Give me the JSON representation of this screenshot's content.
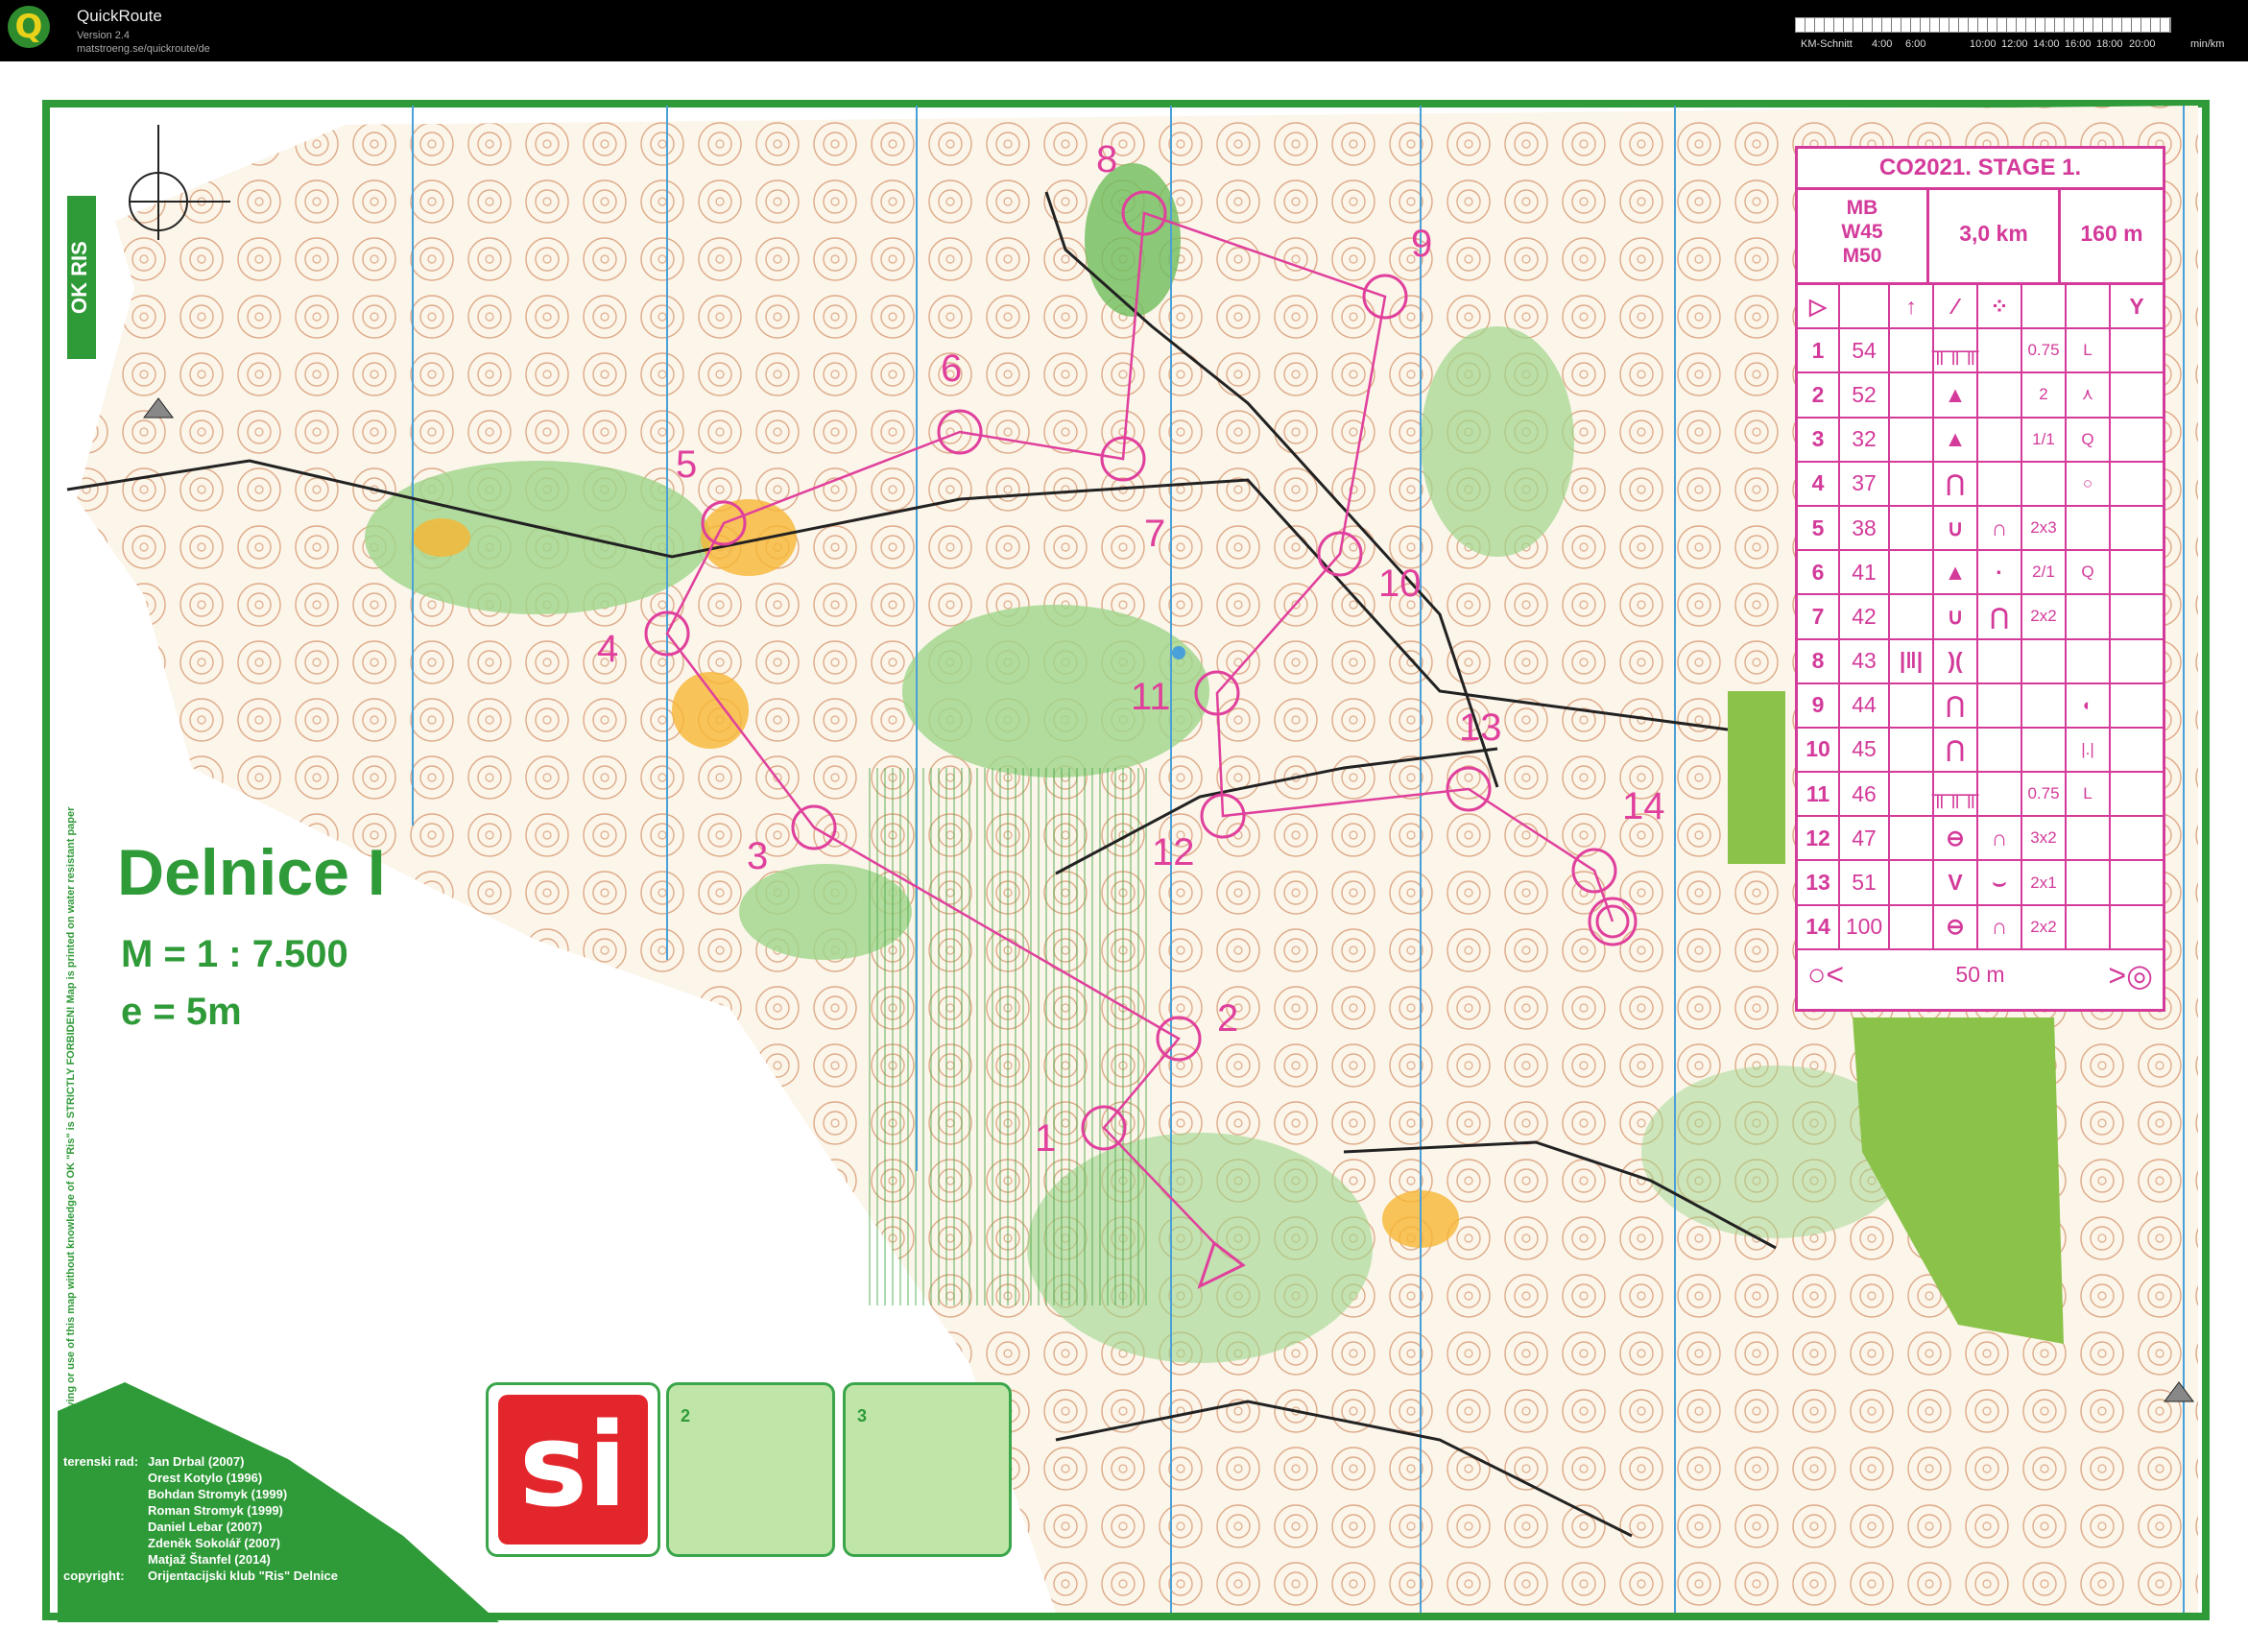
{
  "app": {
    "name": "QuickRoute",
    "version": "Version 2.4",
    "url": "matstroeng.se/quickroute/de"
  },
  "speed_legend": {
    "label": "KM-Schnitt",
    "ticks_a": [
      "4:00",
      "6:00"
    ],
    "ticks_b": [
      "10:00",
      "12:00",
      "14:00",
      "16:00",
      "18:00",
      "20:00"
    ],
    "unit": "min/km"
  },
  "map": {
    "name": "Delnice I",
    "scale": "M = 1 : 7.500",
    "equidistance": "e = 5m",
    "club_logo": "OK RIS",
    "copyright_note": "Any kind of copying or use of this map without knowledge of OK \"Ris\" is STRICTLY FORBIDEN!  Map is printed on water resistant paper",
    "credits": [
      {
        "label": "terenski rad:",
        "name": "Jan Drbal (2007)"
      },
      {
        "label": "",
        "name": "Orest Kotylo (1996)"
      },
      {
        "label": "",
        "name": "Bohdan Stromyk (1999)"
      },
      {
        "label": "",
        "name": "Roman Stromyk (1999)"
      },
      {
        "label": "",
        "name": "Daniel Lebar (2007)"
      },
      {
        "label": "",
        "name": "Zdeněk Sokolář (2007)"
      },
      {
        "label": "",
        "name": "Matjaž Štanfel (2014)"
      },
      {
        "label": "copyright:",
        "name": "Orijentacijski klub \"Ris\" Delnice"
      }
    ],
    "sponsor_logo": "si",
    "promo_numbers": [
      "2",
      "3"
    ]
  },
  "course": {
    "title": "CO2021. STAGE 1.",
    "classes": [
      "MB",
      "W45",
      "M50"
    ],
    "length": "3,0 km",
    "climb": "160 m",
    "controls": [
      {
        "n": "1",
        "code": "54",
        "d": "",
        "e": "╥╥╥",
        "f": "",
        "g": "0.75",
        "h": "L"
      },
      {
        "n": "2",
        "code": "52",
        "d": "",
        "e": "▲",
        "f": "",
        "g": "2",
        "h": "⋏"
      },
      {
        "n": "3",
        "code": "32",
        "d": "",
        "e": "▲",
        "f": "",
        "g": "1/1",
        "h": "Q"
      },
      {
        "n": "4",
        "code": "37",
        "d": "",
        "e": "⋂",
        "f": "",
        "g": "",
        "h": "○"
      },
      {
        "n": "5",
        "code": "38",
        "d": "",
        "e": "∪",
        "f": "∩",
        "g": "2x3",
        "h": ""
      },
      {
        "n": "6",
        "code": "41",
        "d": "",
        "e": "▲",
        "f": "·",
        "g": "2/1",
        "h": "Q"
      },
      {
        "n": "7",
        "code": "42",
        "d": "",
        "e": "∪",
        "f": "⋂",
        "g": "2x2",
        "h": ""
      },
      {
        "n": "8",
        "code": "43",
        "d": "|‖|",
        "e": ")(",
        "f": "",
        "g": "",
        "h": ""
      },
      {
        "n": "9",
        "code": "44",
        "d": "",
        "e": "⋂",
        "f": "",
        "g": "",
        "h": "◐"
      },
      {
        "n": "10",
        "code": "45",
        "d": "",
        "e": "⋂",
        "f": "",
        "g": "",
        "h": "|.|"
      },
      {
        "n": "11",
        "code": "46",
        "d": "",
        "e": "╥╥╥",
        "f": "",
        "g": "0.75",
        "h": "L"
      },
      {
        "n": "12",
        "code": "47",
        "d": "",
        "e": "⊖",
        "f": "∩",
        "g": "3x2",
        "h": ""
      },
      {
        "n": "13",
        "code": "51",
        "d": "",
        "e": "V",
        "f": "⌣",
        "g": "2x1",
        "h": ""
      },
      {
        "n": "14",
        "code": "100",
        "d": "",
        "e": "⊖",
        "f": "∩",
        "g": "2x2",
        "h": ""
      }
    ],
    "finish": "50 m"
  },
  "control_labels": [
    "1",
    "2",
    "3",
    "4",
    "5",
    "6",
    "7",
    "8",
    "9",
    "10",
    "11",
    "12",
    "13",
    "14"
  ],
  "colors": {
    "course": "#e0409c",
    "green": "#2f9a38",
    "contour": "#c8703c",
    "forest": "#9fd68a"
  }
}
